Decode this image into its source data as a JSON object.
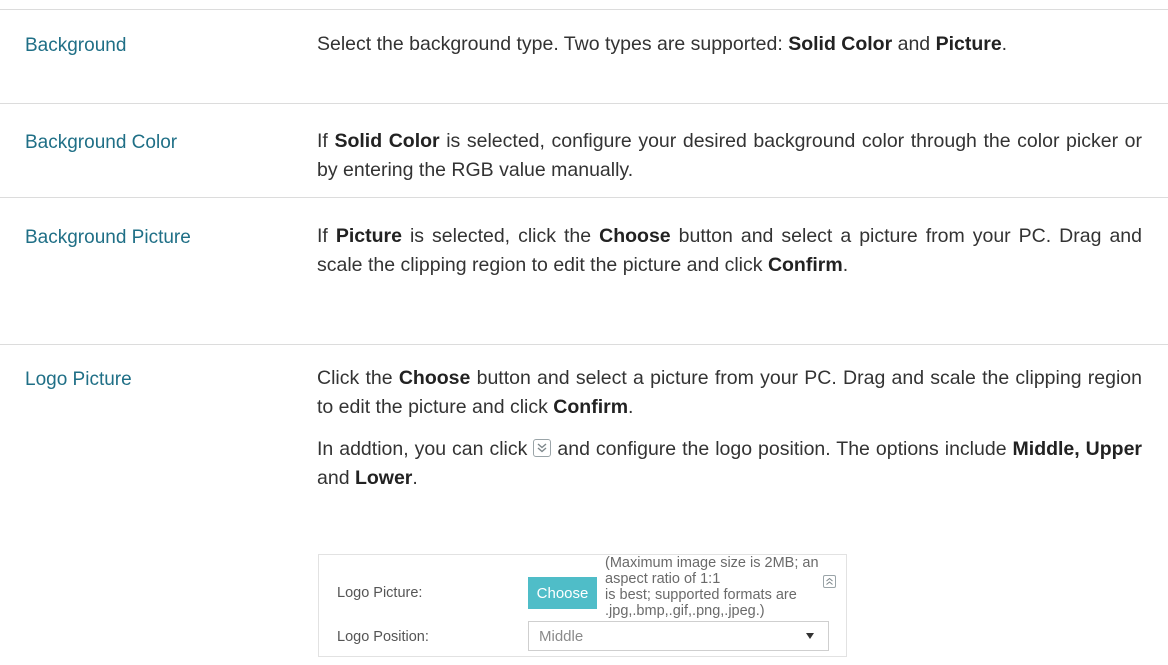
{
  "rows": [
    {
      "term": "Background",
      "desc": {
        "before": "Select the background type. Two types are supported: ",
        "opt1": "Solid Color",
        "mid": " and ",
        "opt2": "Picture",
        "after": "."
      }
    },
    {
      "term": "Background Color",
      "desc": {
        "before": "If ",
        "opt1": "Solid Color",
        "after": " is selected, configure your desired background color through the color picker or by entering the RGB value manually."
      }
    },
    {
      "term": "Background Picture",
      "desc": {
        "before": "If ",
        "opt1": "Picture",
        "mid": " is selected, click the ",
        "opt2": "Choose",
        "mid2": " button and select a picture from your PC. Drag and scale the clipping region to edit the picture and click ",
        "opt3": "Confirm",
        "after": "."
      }
    },
    {
      "term": "Logo Picture",
      "desc": {
        "p1_before": "Click the ",
        "p1_choose": "Choose",
        "p1_mid": " button and select a picture from your PC. Drag and scale the clipping region to edit the picture and click ",
        "p1_confirm": "Confirm",
        "p1_after": ".",
        "p2_before": "In addtion, you can click",
        "p2_mid": "and configure the logo position. The options include ",
        "p2_opts": "Middle, Upper",
        "p2_and": " and ",
        "p2_lower": "Lower",
        "p2_after": "."
      }
    }
  ],
  "panel": {
    "logo_picture_label": "Logo Picture:",
    "choose_button": "Choose",
    "hint_line1": "(Maximum image size is 2MB; an aspect ratio of 1:1",
    "hint_line2": "is best; supported formats are",
    "hint_line3": ".jpg,.bmp,.gif,.png,.jpeg.)",
    "logo_position_label": "Logo Position:",
    "logo_position_value": "Middle"
  },
  "icons": {
    "expand": "double-chevron-down-icon",
    "collapse": "double-chevron-up-icon",
    "dropdown": "caret-down-icon"
  },
  "colors": {
    "term": "#1f6f86",
    "button": "#4fbdc8",
    "divider": "#dcdcdc"
  }
}
